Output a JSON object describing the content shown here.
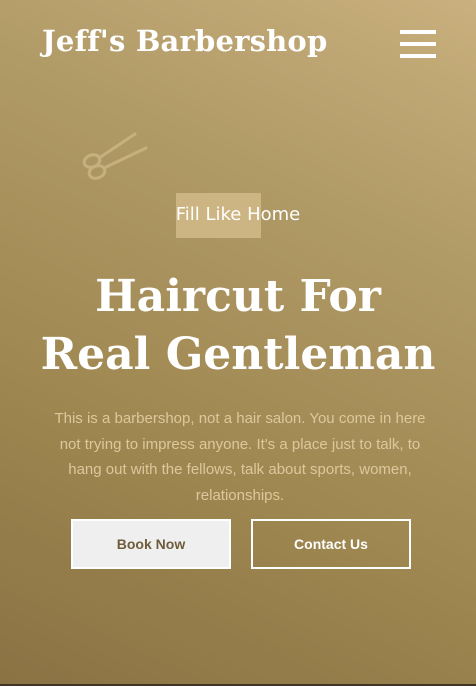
{
  "header": {
    "brand": "Jeff's Barbershop",
    "menu_icon": "hamburger-menu-icon"
  },
  "hero": {
    "decor_icon": "scissors-icon",
    "tagline": "Fill Like Home",
    "title_line1": "Haircut For",
    "title_line2": "Real Gentleman",
    "description": "This is a barbershop, not a hair salon. You come in here not trying to impress anyone. It's a place just to talk, to hang out with the fellows, talk about sports, women, relationships.",
    "book_label": "Book Now",
    "contact_label": "Contact Us"
  },
  "colors": {
    "gold_light": "#c9b07e",
    "gold_dark": "#8a7244",
    "tag_highlight": "#cdb583",
    "description_text": "#dcc89c",
    "book_button_text": "#6e5c3a"
  }
}
